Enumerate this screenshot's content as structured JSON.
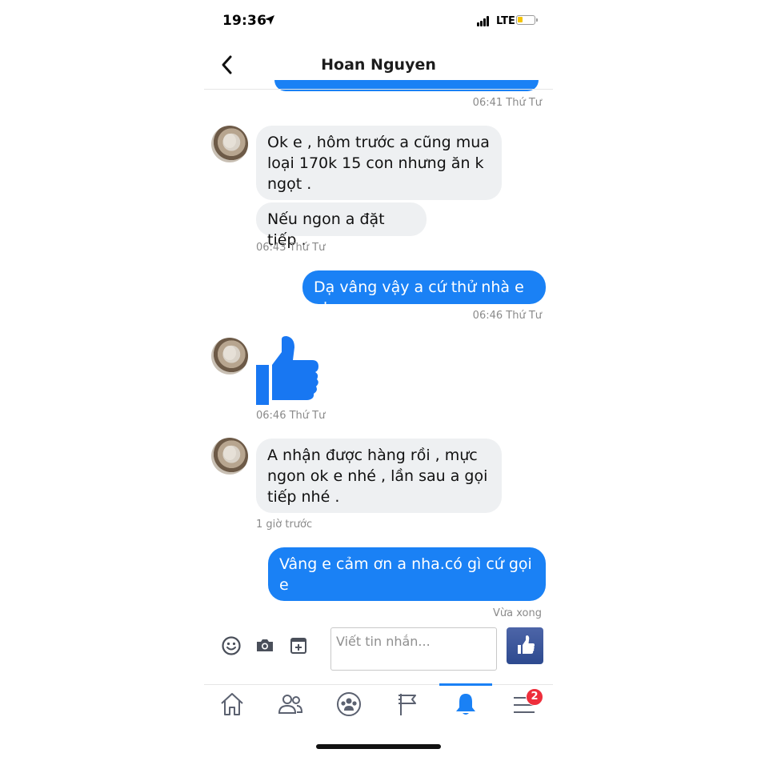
{
  "status_bar": {
    "time": "19:36",
    "network": "LTE"
  },
  "header": {
    "title": "Hoan Nguyen"
  },
  "messages": [
    {
      "timestamp": "06:41 Thứ Tư"
    },
    {
      "lines": [
        "Ok e , hôm trước a cũng mua",
        "loại 170k 15 con nhưng ăn k",
        "ngọt ."
      ]
    },
    {
      "text": "Nếu ngon a đặt tiếp ."
    },
    {
      "timestamp": "06:43 Thứ Tư"
    },
    {
      "text": "Dạ vâng vậy a cứ thử nhà e nha"
    },
    {
      "timestamp": "06:46 Thứ Tư"
    },
    {
      "timestamp": "06:46 Thứ Tư"
    },
    {
      "lines": [
        "A nhận được hàng rồi , mực",
        "ngon ok e nhé , lần sau a gọi",
        "tiếp nhé ."
      ]
    },
    {
      "timestamp": "1 giờ trước"
    },
    {
      "lines": [
        "Vâng e cảm ơn a nha.có gì cứ gọi e",
        "ạ"
      ]
    },
    {
      "timestamp": "Vừa xong"
    }
  ],
  "composer": {
    "placeholder": "Viết tin nhắn..."
  },
  "bottom_nav": {
    "items": [
      {
        "icon": "home-icon"
      },
      {
        "icon": "friends-icon"
      },
      {
        "icon": "groups-icon"
      },
      {
        "icon": "pages-flag-icon"
      },
      {
        "icon": "notifications-bell-icon",
        "active": true
      },
      {
        "icon": "menu-icon",
        "badge": "2"
      }
    ]
  },
  "colors": {
    "accent": "#1a81f5",
    "incoming_bubble": "#eef0f2",
    "badge": "#ee2e3b",
    "send_button": "#3b5998"
  }
}
